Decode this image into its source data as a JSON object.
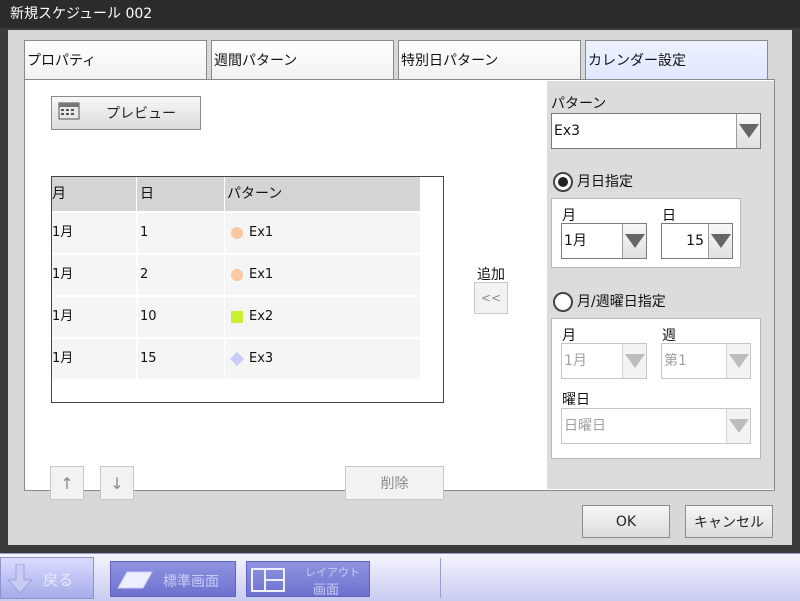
{
  "window": {
    "title": "新規スケジュール 002"
  },
  "tabs": [
    {
      "label": "プロパティ"
    },
    {
      "label": "週間パターン"
    },
    {
      "label": "特別日パターン"
    },
    {
      "label": "カレンダー設定"
    }
  ],
  "preview_button": {
    "label": "プレビュー",
    "icon": "calendar-icon"
  },
  "table": {
    "headers": [
      "月",
      "日",
      "パターン"
    ],
    "rows": [
      {
        "month": "1月",
        "day": "1",
        "pattern": "Ex1",
        "marker": "circle",
        "color": "#f8c9a2"
      },
      {
        "month": "1月",
        "day": "2",
        "pattern": "Ex1",
        "marker": "circle",
        "color": "#f8c9a2"
      },
      {
        "month": "1月",
        "day": "10",
        "pattern": "Ex2",
        "marker": "square",
        "color": "#c8f030"
      },
      {
        "month": "1月",
        "day": "15",
        "pattern": "Ex3",
        "marker": "diamond",
        "color": "#c9cdf8"
      }
    ]
  },
  "add": {
    "label": "追加",
    "button": "<<"
  },
  "move": {
    "up": "↑",
    "down": "↓"
  },
  "delete_button": "削除",
  "pattern": {
    "label": "パターン",
    "value": "Ex3"
  },
  "date_mode": {
    "label": "月日指定",
    "selected": true,
    "month_label": "月",
    "month_value": "1月",
    "day_label": "日",
    "day_value": "15"
  },
  "weekday_mode": {
    "label": "月/週曜日指定",
    "selected": false,
    "month_label": "月",
    "month_value": "1月",
    "week_label": "週",
    "week_value": "第1",
    "dow_label": "曜日",
    "dow_value": "日曜日"
  },
  "footer": {
    "ok": "OK",
    "cancel": "キャンセル"
  },
  "taskbar": {
    "back": "戻る",
    "standard": "標準画面",
    "layout_line1": "レイアウト",
    "layout_line2": "画面"
  }
}
